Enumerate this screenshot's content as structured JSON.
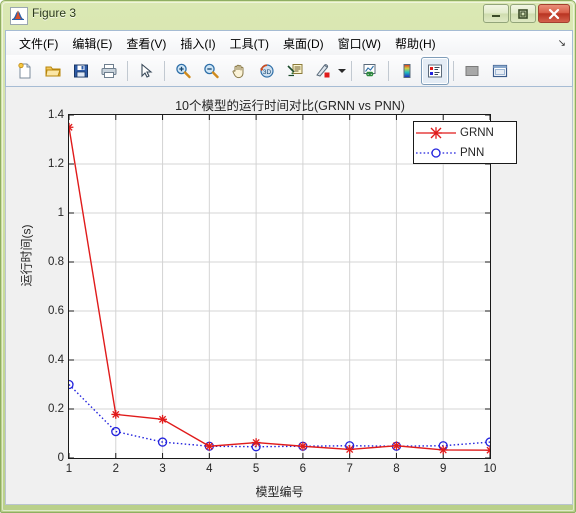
{
  "window": {
    "title": "Figure 3",
    "icon": "matlab-membrane-icon",
    "buttons": {
      "minimize": "minimize-icon",
      "maximize": "maximize-icon",
      "close": "close-icon"
    }
  },
  "menubar": {
    "items": [
      {
        "label": "文件(F)"
      },
      {
        "label": "编辑(E)"
      },
      {
        "label": "查看(V)"
      },
      {
        "label": "插入(I)"
      },
      {
        "label": "工具(T)"
      },
      {
        "label": "桌面(D)"
      },
      {
        "label": "窗口(W)"
      },
      {
        "label": "帮助(H)"
      }
    ],
    "overflow": "↘"
  },
  "toolbar": {
    "items": [
      {
        "name": "new-figure-icon",
        "pressed": false
      },
      {
        "name": "open-file-icon",
        "pressed": false
      },
      {
        "name": "save-figure-icon",
        "pressed": false
      },
      {
        "name": "print-figure-icon",
        "pressed": false
      },
      {
        "name": "pointer-select-icon",
        "pressed": false
      },
      {
        "name": "zoom-in-icon",
        "pressed": false
      },
      {
        "name": "zoom-out-icon",
        "pressed": false
      },
      {
        "name": "pan-hand-icon",
        "pressed": false
      },
      {
        "name": "rotate-3d-icon",
        "pressed": false
      },
      {
        "name": "data-cursor-icon",
        "pressed": false
      },
      {
        "name": "brush-data-icon",
        "pressed": false
      },
      {
        "name": "link-plot-icon",
        "pressed": false
      },
      {
        "name": "insert-colorbar-icon",
        "pressed": false
      },
      {
        "name": "insert-legend-icon",
        "pressed": true
      },
      {
        "name": "hide-plot-tools-icon",
        "pressed": false
      },
      {
        "name": "show-plot-tools-icon",
        "pressed": false
      }
    ]
  },
  "chart_data": {
    "type": "line",
    "title": "10个模型的运行时间对比(GRNN vs PNN)",
    "xlabel": "模型编号",
    "ylabel": "运行时间(s)",
    "x": [
      1,
      2,
      3,
      4,
      5,
      6,
      7,
      8,
      9,
      10
    ],
    "xtick_labels": [
      "1",
      "2",
      "3",
      "4",
      "5",
      "6",
      "7",
      "8",
      "9",
      "10"
    ],
    "ytick_labels": [
      "0",
      "0.2",
      "0.4",
      "0.6",
      "0.8",
      "1",
      "1.2",
      "1.4"
    ],
    "yticks": [
      0,
      0.2,
      0.4,
      0.6,
      0.8,
      1.0,
      1.2,
      1.4
    ],
    "xlim": [
      1,
      10
    ],
    "ylim": [
      0,
      1.4
    ],
    "grid": true,
    "legend_position": "top-right",
    "series": [
      {
        "name": "GRNN",
        "color": "#e01b1b",
        "linestyle": "solid",
        "marker": "asterisk",
        "values": [
          1.35,
          0.178,
          0.158,
          0.048,
          0.063,
          0.048,
          0.035,
          0.05,
          0.033,
          0.032
        ]
      },
      {
        "name": "PNN",
        "color": "#2222dd",
        "linestyle": "dotted",
        "marker": "circle",
        "values": [
          0.3,
          0.108,
          0.065,
          0.048,
          0.046,
          0.048,
          0.05,
          0.048,
          0.05,
          0.065
        ]
      }
    ]
  },
  "colors": {
    "grnn": "#e01b1b",
    "pnn": "#2222dd",
    "grid": "#d4d4d4",
    "axis": "#1a1a1a",
    "figure_bg": "#f0f0f0",
    "window_chrome": "#cfe0a2",
    "close_button": "#c0392b"
  }
}
